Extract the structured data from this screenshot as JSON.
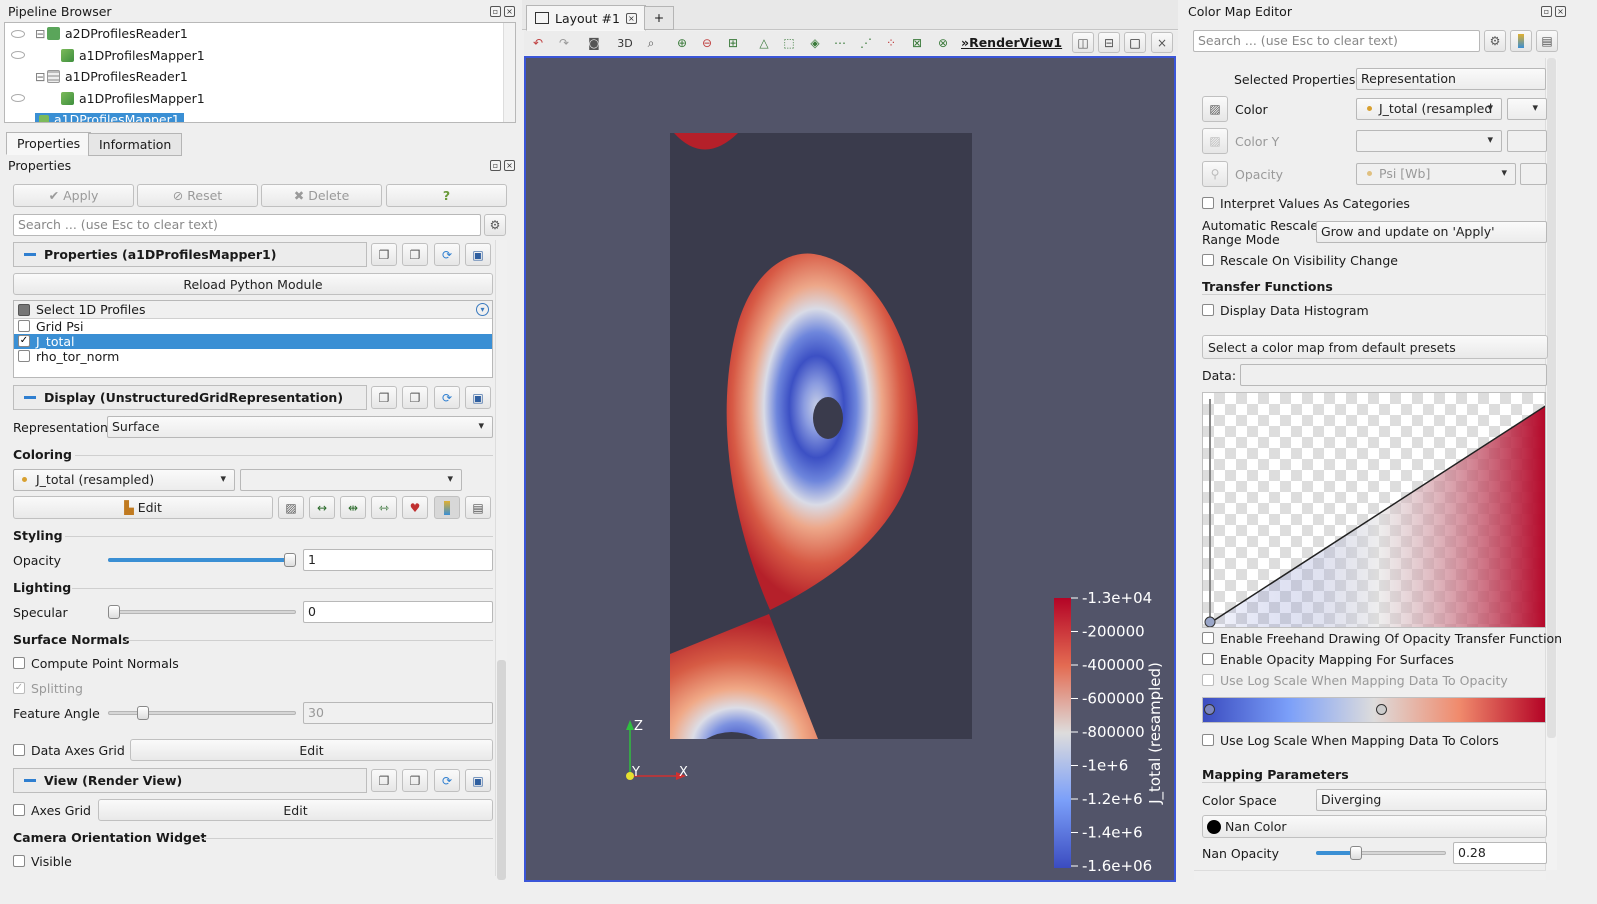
{
  "pipeline": {
    "title": "Pipeline Browser",
    "items": [
      {
        "label": "a2DProfilesReader1",
        "icon": "reader-icon"
      },
      {
        "label": "a1DProfilesMapper1",
        "icon": "filter-icon"
      },
      {
        "label": "a1DProfilesReader1",
        "icon": "table-icon"
      },
      {
        "label": "a1DProfilesMapper1",
        "icon": "filter-icon"
      },
      {
        "label": "a1DProfilesMapper1",
        "icon": "filter-icon"
      }
    ]
  },
  "props_tabs": [
    "Properties",
    "Information"
  ],
  "props": {
    "title": "Properties",
    "apply": "Apply",
    "reset": "Reset",
    "delete": "Delete",
    "help": "?",
    "search_placeholder": "Search ... (use Esc to clear text)",
    "section_props": "Properties (a1DProfilesMapper1)",
    "reload": "Reload Python Module",
    "select_header": "Select 1D Profiles",
    "profiles": [
      {
        "label": "Grid Psi",
        "checked": false
      },
      {
        "label": "J_total",
        "checked": true
      },
      {
        "label": "rho_tor_norm",
        "checked": false
      }
    ],
    "section_display": "Display (UnstructuredGridRepresentation)",
    "representation_label": "Representation",
    "representation_value": "Surface",
    "coloring": "Coloring",
    "coloring_value": "J_total (resampled)",
    "edit": "Edit",
    "styling": "Styling",
    "opacity_label": "Opacity",
    "opacity_value": "1",
    "opacity_level": 1.0,
    "lighting": "Lighting",
    "specular_label": "Specular",
    "specular_value": "0",
    "surface_normals": "Surface Normals",
    "compute_normals": "Compute Point Normals",
    "splitting": "Splitting",
    "feature_angle_label": "Feature Angle",
    "feature_angle_value": "30",
    "data_axes_grid": "Data Axes Grid",
    "data_axes_edit": "Edit",
    "section_view": "View (Render View)",
    "axes_grid": "Axes Grid",
    "axes_edit": "Edit",
    "camera_widget": "Camera Orientation Widget",
    "visible": "Visible"
  },
  "layout": {
    "tab": "Layout #1",
    "add_tab": "+",
    "btn_3d": "3D",
    "view_name": "RenderView1"
  },
  "render": {
    "axis_z": "Z",
    "axis_y": "Y",
    "axis_x": "X",
    "colorbar_title": "J_total (resampled)",
    "colorbar_ticks": [
      "-1.3e+04",
      "-200000",
      "-400000",
      "-600000",
      "-800000",
      "-1e+6",
      "-1.2e+6",
      "-1.4e+6",
      "-1.6e+06"
    ],
    "bg_color": "#525469",
    "domain_color": "#3a3b4c"
  },
  "cme": {
    "title": "Color Map Editor",
    "search_placeholder": "Search ... (use Esc to clear text)",
    "selected_props_label": "Selected Properties",
    "selected_props_value": "Representation",
    "color_label": "Color",
    "color_value": "J_total (resampled",
    "color_y_label": "Color Y",
    "opacity_label": "Opacity",
    "opacity_value": "Psi [Wb]",
    "interpret": "Interpret Values As Categories",
    "auto_rescale_1": "Automatic Rescale",
    "auto_rescale_2": "Range Mode",
    "auto_rescale_value": "Grow and update on 'Apply'",
    "rescale_visibility": "Rescale On Visibility Change",
    "transfer_functions": "Transfer Functions",
    "display_histogram": "Display Data Histogram",
    "preset": "Select a color map from default presets",
    "data_label": "Data:",
    "freehand": "Enable Freehand Drawing Of Opacity Transfer Function",
    "opacity_mapping": "Enable Opacity Mapping For Surfaces",
    "log_opacity": "Use Log Scale When Mapping Data To Opacity",
    "log_colors": "Use Log Scale When Mapping Data To Colors",
    "mapping_params": "Mapping Parameters",
    "color_space_label": "Color Space",
    "color_space_value": "Diverging",
    "nan_color": "Nan Color",
    "nan_opacity_label": "Nan Opacity",
    "nan_opacity_value": "0.28",
    "nan_opacity_level": 0.28
  }
}
